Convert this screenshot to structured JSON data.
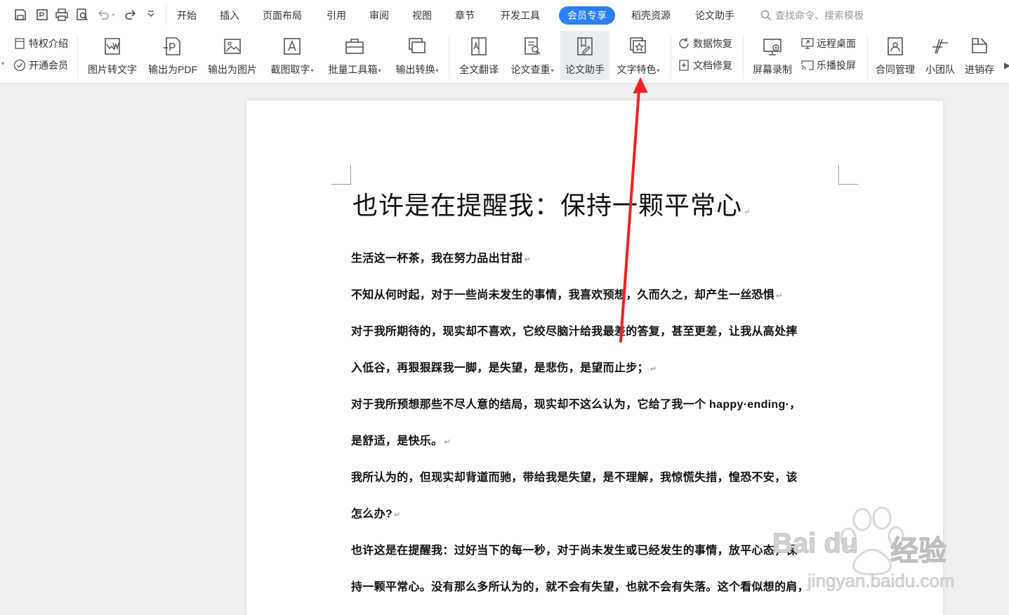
{
  "menu": {
    "tabs": [
      "开始",
      "插入",
      "页面布局",
      "引用",
      "审阅",
      "视图",
      "章节",
      "开发工具",
      "会员专享",
      "稻壳资源",
      "论文助手"
    ],
    "active_tab": "会员专享",
    "search_placeholder": "查找命令、搜索模板"
  },
  "ribbon": {
    "privilege_intro": "特权介绍",
    "open_membership": "开通会员",
    "img_to_text": "图片转文字",
    "export_pdf": "输出为PDF",
    "export_image": "输出为图片",
    "screenshot_ocr": "截图取字",
    "batch_tools": "批量工具箱",
    "export_convert": "输出转换",
    "full_translate": "全文翻译",
    "paper_check": "论文查重",
    "paper_assistant": "论文助手",
    "text_features": "文字特色",
    "data_recovery": "数据恢复",
    "doc_repair": "文档修复",
    "screen_record": "屏幕录制",
    "remote_desktop": "远程桌面",
    "cast_screen": "乐播投屏",
    "contract_mgmt": "合同管理",
    "small_team": "小团队",
    "inventory": "进销存"
  },
  "document": {
    "title": "也许是在提醒我：保持一颗平常心",
    "paragraphs": [
      "生活这一杯茶，我在努力品出甘甜",
      "不知从何时起，对于一些尚未发生的事情，我喜欢预想，久而久之，却产生一丝恐惧",
      "对于我所期待的，现实却不喜欢，它绞尽脑汁给我最差的答复，甚至更差，让我从高处摔",
      "入低谷，再狠狠踩我一脚，是失望，是悲伤，是望而止步；",
      "对于我所预想那些不尽人意的结局，现实却不这么认为，它给了我一个 happy·ending·，",
      "是舒适，是快乐。",
      "我所认为的，但现实却背道而驰，带给我是失望，是不理解，我惊慌失措，惶恐不安，该",
      "怎么办?",
      "也许这是在提醒我：过好当下的每一秒，对于尚未发生或已经发生的事情，放平心态，保",
      "持一颗平常心。没有那么多所认为的，就不会有失望，也就不会有失落。这个看似想的肩，"
    ],
    "paragraph_mark": "↵"
  },
  "watermark": {
    "brand": "Bai du",
    "brand_cn": "经验",
    "url": "jingyan.baidu.com"
  },
  "colors": {
    "accent": "#2a7ff5",
    "arrow": "#ee2222"
  }
}
